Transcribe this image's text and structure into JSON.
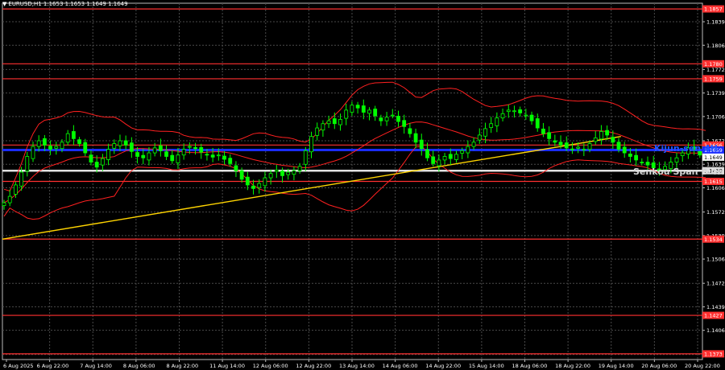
{
  "header": {
    "symbol_line": "EURUSD,H1  1.1653 1.1653 1.1649 1.1649"
  },
  "overlays": {
    "kijun_label": "Kijun-sen 4H",
    "senkou_label": "Senkou Span B 4H"
  },
  "chart_data": {
    "type": "candlestick",
    "symbol": "EURUSD",
    "timeframe": "H1",
    "ohlc_last": {
      "open": 1.1653,
      "high": 1.1653,
      "low": 1.1649,
      "close": 1.1649
    },
    "ylim": [
      1.1365,
      1.1865
    ],
    "y_ticks": [
      "1.1839",
      "1.1806",
      "1.1772",
      "1.1739",
      "1.1706",
      "1.1672",
      "1.1639",
      "1.1606",
      "1.1572",
      "1.1539",
      "1.1506",
      "1.1472",
      "1.1439",
      "1.1406",
      "1.1372"
    ],
    "x_ticks": [
      "6 Aug 2025",
      "6 Aug 22:00",
      "7 Aug 14:00",
      "8 Aug 06:00",
      "8 Aug 22:00",
      "11 Aug 14:00",
      "12 Aug 06:00",
      "12 Aug 22:00",
      "13 Aug 14:00",
      "14 Aug 06:00",
      "14 Aug 22:00",
      "15 Aug 14:00",
      "18 Aug 06:00",
      "18 Aug 22:00",
      "19 Aug 14:00",
      "20 Aug 06:00",
      "20 Aug 22:00"
    ],
    "current_price": "1.1649",
    "red_levels": [
      {
        "price": 1.1857,
        "label": "1.1857"
      },
      {
        "price": 1.178,
        "label": "1.1780"
      },
      {
        "price": 1.1759,
        "label": "1.1759"
      },
      {
        "price": 1.1666,
        "label": "1.1666"
      },
      {
        "price": 1.1615,
        "label": "1.1615"
      },
      {
        "price": 1.1534,
        "label": "1.1534"
      },
      {
        "price": 1.1427,
        "label": "1.1427"
      },
      {
        "price": 1.1373,
        "label": "1.1373"
      }
    ],
    "kijun_sen_4h": {
      "price": 1.1659,
      "label": "1.1659"
    },
    "senkou_span_b_4h": {
      "price": 1.163,
      "label": "1.1630"
    },
    "trendline": {
      "from": [
        "6 Aug 2025",
        1.1534
      ],
      "to": [
        "19 Aug 14:00",
        1.1678
      ]
    },
    "colors": {
      "background": "#000000",
      "candles": "#00ff00",
      "grid": "#4a4a4a",
      "red_level": "#ff3030",
      "bollinger": "#ff2020",
      "kijun": "#1a2cff",
      "senkou": "#e0e0e0",
      "trendline": "#ffd400"
    },
    "closes": [
      1.1585,
      1.1594,
      1.161,
      1.1628,
      1.165,
      1.1664,
      1.1672,
      1.1666,
      1.166,
      1.1664,
      1.167,
      1.1682,
      1.1675,
      1.1668,
      1.1655,
      1.1642,
      1.1635,
      1.1647,
      1.166,
      1.1668,
      1.1672,
      1.1666,
      1.1657,
      1.165,
      1.1648,
      1.1655,
      1.1662,
      1.1658,
      1.165,
      1.1644,
      1.1652,
      1.166,
      1.1664,
      1.1661,
      1.1656,
      1.1652,
      1.1649,
      1.1652,
      1.1646,
      1.164,
      1.163,
      1.1618,
      1.161,
      1.1605,
      1.1612,
      1.162,
      1.1626,
      1.1631,
      1.1623,
      1.1628,
      1.163,
      1.1636,
      1.1658,
      1.1678,
      1.169,
      1.1696,
      1.17,
      1.1696,
      1.1702,
      1.1715,
      1.1722,
      1.1718,
      1.1712,
      1.1715,
      1.1707,
      1.17,
      1.1705,
      1.1708,
      1.1699,
      1.1692,
      1.1682,
      1.167,
      1.1661,
      1.1648,
      1.164,
      1.1645,
      1.165,
      1.1647,
      1.1653,
      1.1658,
      1.1664,
      1.167,
      1.168,
      1.1689,
      1.1696,
      1.1704,
      1.171,
      1.1715,
      1.1714,
      1.1711,
      1.1708,
      1.17,
      1.169,
      1.1682,
      1.1675,
      1.167,
      1.1666,
      1.1662,
      1.166,
      1.1663,
      1.166,
      1.1668,
      1.1676,
      1.1685,
      1.168,
      1.167,
      1.166,
      1.1655,
      1.165,
      1.1645,
      1.1642,
      1.1638,
      1.1634,
      1.163,
      1.1636,
      1.1642,
      1.1648,
      1.1655,
      1.1662,
      1.166,
      1.1652,
      1.1649
    ]
  }
}
